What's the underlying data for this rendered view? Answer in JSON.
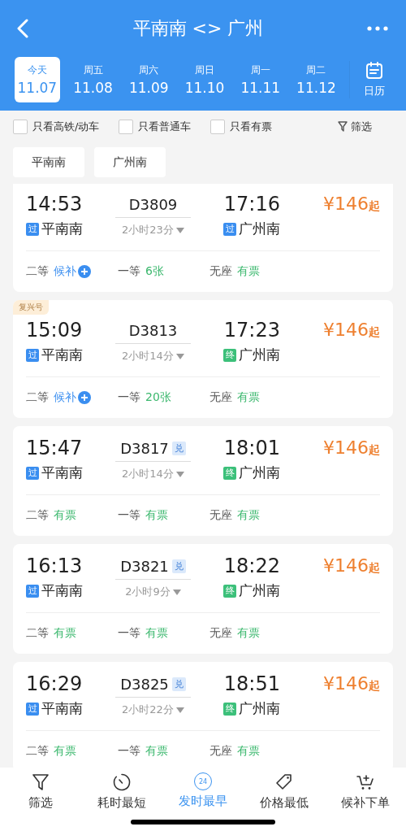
{
  "header": {
    "title": "平南南 <> 广州"
  },
  "dates": [
    {
      "weekday": "今天",
      "date": "11.07",
      "selected": true
    },
    {
      "weekday": "周五",
      "date": "11.08",
      "selected": false
    },
    {
      "weekday": "周六",
      "date": "11.09",
      "selected": false
    },
    {
      "weekday": "周日",
      "date": "11.10",
      "selected": false
    },
    {
      "weekday": "周一",
      "date": "11.11",
      "selected": false
    },
    {
      "weekday": "周二",
      "date": "11.12",
      "selected": false
    }
  ],
  "calendar": {
    "label": "日历"
  },
  "filters": [
    {
      "label": "只看高铁/动车",
      "checked": false
    },
    {
      "label": "只看普通车",
      "checked": false
    },
    {
      "label": "只看有票",
      "checked": false
    }
  ],
  "filter_button": {
    "label": "筛选"
  },
  "stations": [
    "平南南",
    "广州南"
  ],
  "trains": [
    {
      "depart": "14:53",
      "train_no": "D3809",
      "arrive": "17:16",
      "from_tag": {
        "label": "过",
        "kind": "pass"
      },
      "from": "平南南",
      "to_tag": {
        "label": "过",
        "kind": "pass"
      },
      "to": "广州南",
      "duration": "2小时23分",
      "price": "¥146",
      "price_suffix": "起",
      "seats": [
        {
          "class": "二等",
          "status": "候补",
          "kind": "waitlist"
        },
        {
          "class": "一等",
          "status": "6张",
          "kind": "available"
        },
        {
          "class": "无座",
          "status": "有票",
          "kind": "available"
        }
      ]
    },
    {
      "brand": "复兴号",
      "depart": "15:09",
      "train_no": "D3813",
      "arrive": "17:23",
      "from_tag": {
        "label": "过",
        "kind": "pass"
      },
      "from": "平南南",
      "to_tag": {
        "label": "终",
        "kind": "terminal"
      },
      "to": "广州南",
      "duration": "2小时14分",
      "price": "¥146",
      "price_suffix": "起",
      "seats": [
        {
          "class": "二等",
          "status": "候补",
          "kind": "waitlist"
        },
        {
          "class": "一等",
          "status": "20张",
          "kind": "available"
        },
        {
          "class": "无座",
          "status": "有票",
          "kind": "available"
        }
      ]
    },
    {
      "depart": "15:47",
      "train_no": "D3817",
      "train_badge": "兑",
      "arrive": "18:01",
      "from_tag": {
        "label": "过",
        "kind": "pass"
      },
      "from": "平南南",
      "to_tag": {
        "label": "终",
        "kind": "terminal"
      },
      "to": "广州南",
      "duration": "2小时14分",
      "price": "¥146",
      "price_suffix": "起",
      "seats": [
        {
          "class": "二等",
          "status": "有票",
          "kind": "available"
        },
        {
          "class": "一等",
          "status": "有票",
          "kind": "available"
        },
        {
          "class": "无座",
          "status": "有票",
          "kind": "available"
        }
      ]
    },
    {
      "depart": "16:13",
      "train_no": "D3821",
      "train_badge": "兑",
      "arrive": "18:22",
      "from_tag": {
        "label": "过",
        "kind": "pass"
      },
      "from": "平南南",
      "to_tag": {
        "label": "终",
        "kind": "terminal"
      },
      "to": "广州南",
      "duration": "2小时9分",
      "price": "¥146",
      "price_suffix": "起",
      "seats": [
        {
          "class": "二等",
          "status": "有票",
          "kind": "available"
        },
        {
          "class": "一等",
          "status": "有票",
          "kind": "available"
        },
        {
          "class": "无座",
          "status": "有票",
          "kind": "available"
        }
      ]
    },
    {
      "depart": "16:29",
      "train_no": "D3825",
      "train_badge": "兑",
      "arrive": "18:51",
      "from_tag": {
        "label": "过",
        "kind": "pass"
      },
      "from": "平南南",
      "to_tag": {
        "label": "终",
        "kind": "terminal"
      },
      "to": "广州南",
      "duration": "2小时22分",
      "price": "¥146",
      "price_suffix": "起",
      "seats": [
        {
          "class": "二等",
          "status": "有票",
          "kind": "available"
        },
        {
          "class": "一等",
          "status": "有票",
          "kind": "available"
        },
        {
          "class": "无座",
          "status": "有票",
          "kind": "available"
        }
      ]
    }
  ],
  "bottom_tabs": [
    {
      "label": "筛选",
      "kind": "filter",
      "selected": false
    },
    {
      "label": "耗时最短",
      "kind": "timer",
      "selected": false
    },
    {
      "label": "发时最早",
      "kind": "clock",
      "icon_text": "24",
      "selected": true
    },
    {
      "label": "价格最低",
      "kind": "tag",
      "selected": false
    },
    {
      "label": "候补下单",
      "kind": "cart",
      "selected": false
    }
  ]
}
